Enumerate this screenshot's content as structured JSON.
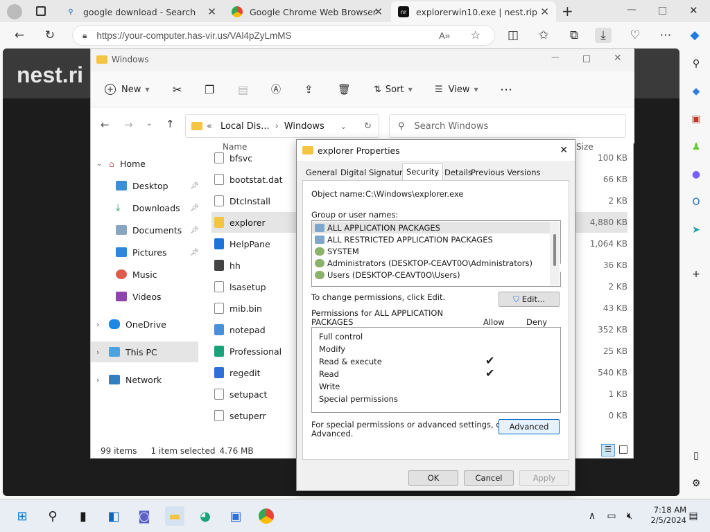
{
  "browser": {
    "tabs": [
      {
        "label": "google download - Search",
        "fav": "Q"
      },
      {
        "label": "Google Chrome Web Browser",
        "fav": "G"
      },
      {
        "label": "explorerwin10.exe | nest.rip",
        "fav": "nr"
      }
    ],
    "url": "https://your-computer.has-vir.us/VAl4pZyLmMS",
    "page_brand": "nest.ri"
  },
  "explorer": {
    "title": "Windows",
    "toolbar": {
      "new": "New",
      "sort": "Sort",
      "view": "View"
    },
    "path_prefix": "«",
    "path": [
      "Local Dis...",
      "Windows"
    ],
    "search_placeholder": "Search Windows",
    "col_name": "Name",
    "col_size": "Size",
    "nav": [
      {
        "label": "Home"
      },
      {
        "label": "Desktop"
      },
      {
        "label": "Downloads"
      },
      {
        "label": "Documents"
      },
      {
        "label": "Pictures"
      },
      {
        "label": "Music"
      },
      {
        "label": "Videos"
      },
      {
        "label": "OneDrive"
      },
      {
        "label": "This PC"
      },
      {
        "label": "Network"
      }
    ],
    "files": [
      {
        "name": "bfsvc",
        "size": "100 KB"
      },
      {
        "name": "bootstat.dat",
        "size": "66 KB"
      },
      {
        "name": "DtcInstall",
        "size": "2 KB"
      },
      {
        "name": "explorer",
        "size": "4,880 KB"
      },
      {
        "name": "HelpPane",
        "size": "1,064 KB"
      },
      {
        "name": "hh",
        "size": "36 KB"
      },
      {
        "name": "lsasetup",
        "size": "2 KB"
      },
      {
        "name": "mib.bin",
        "size": "43 KB"
      },
      {
        "name": "notepad",
        "size": "352 KB"
      },
      {
        "name": "Professional",
        "size": "25 KB"
      },
      {
        "name": "regedit",
        "size": "540 KB"
      },
      {
        "name": "setupact",
        "size": "1 KB"
      },
      {
        "name": "setuperr",
        "size": "0 KB"
      }
    ],
    "status": {
      "items": "99 items",
      "selected": "1 item selected",
      "size": "4.76 MB"
    }
  },
  "dialog": {
    "title": "explorer Properties",
    "tabs": [
      "General",
      "Digital Signatures",
      "Security",
      "Details",
      "Previous Versions"
    ],
    "object_label": "Object name:",
    "object_value": "C:\\Windows\\explorer.exe",
    "group_label": "Group or user names:",
    "groups": [
      "ALL APPLICATION PACKAGES",
      "ALL RESTRICTED APPLICATION PACKAGES",
      "SYSTEM",
      "Administrators (DESKTOP-CEAVT0O\\Administrators)",
      "Users (DESKTOP-CEAVT0O\\Users)"
    ],
    "change_text": "To change permissions, click Edit.",
    "edit": "Edit...",
    "perm_for_line1": "Permissions for ALL APPLICATION",
    "perm_for_line2": "PACKAGES",
    "allow": "Allow",
    "deny": "Deny",
    "permissions": [
      {
        "name": "Full control",
        "allow": ""
      },
      {
        "name": "Modify",
        "allow": ""
      },
      {
        "name": "Read & execute",
        "allow": "✔"
      },
      {
        "name": "Read",
        "allow": "✔"
      },
      {
        "name": "Write",
        "allow": ""
      },
      {
        "name": "Special permissions",
        "allow": ""
      }
    ],
    "adv_line1": "For special permissions or advanced settings, click",
    "adv_line2": "Advanced.",
    "advanced": "Advanced",
    "ok": "OK",
    "cancel": "Cancel",
    "apply": "Apply"
  },
  "taskbar": {
    "time": "7:18 AM",
    "date": "2/5/2024"
  },
  "colors": {
    "accent": "#0067c0",
    "folder": "#f4c542",
    "selected": "#cce4f7"
  }
}
